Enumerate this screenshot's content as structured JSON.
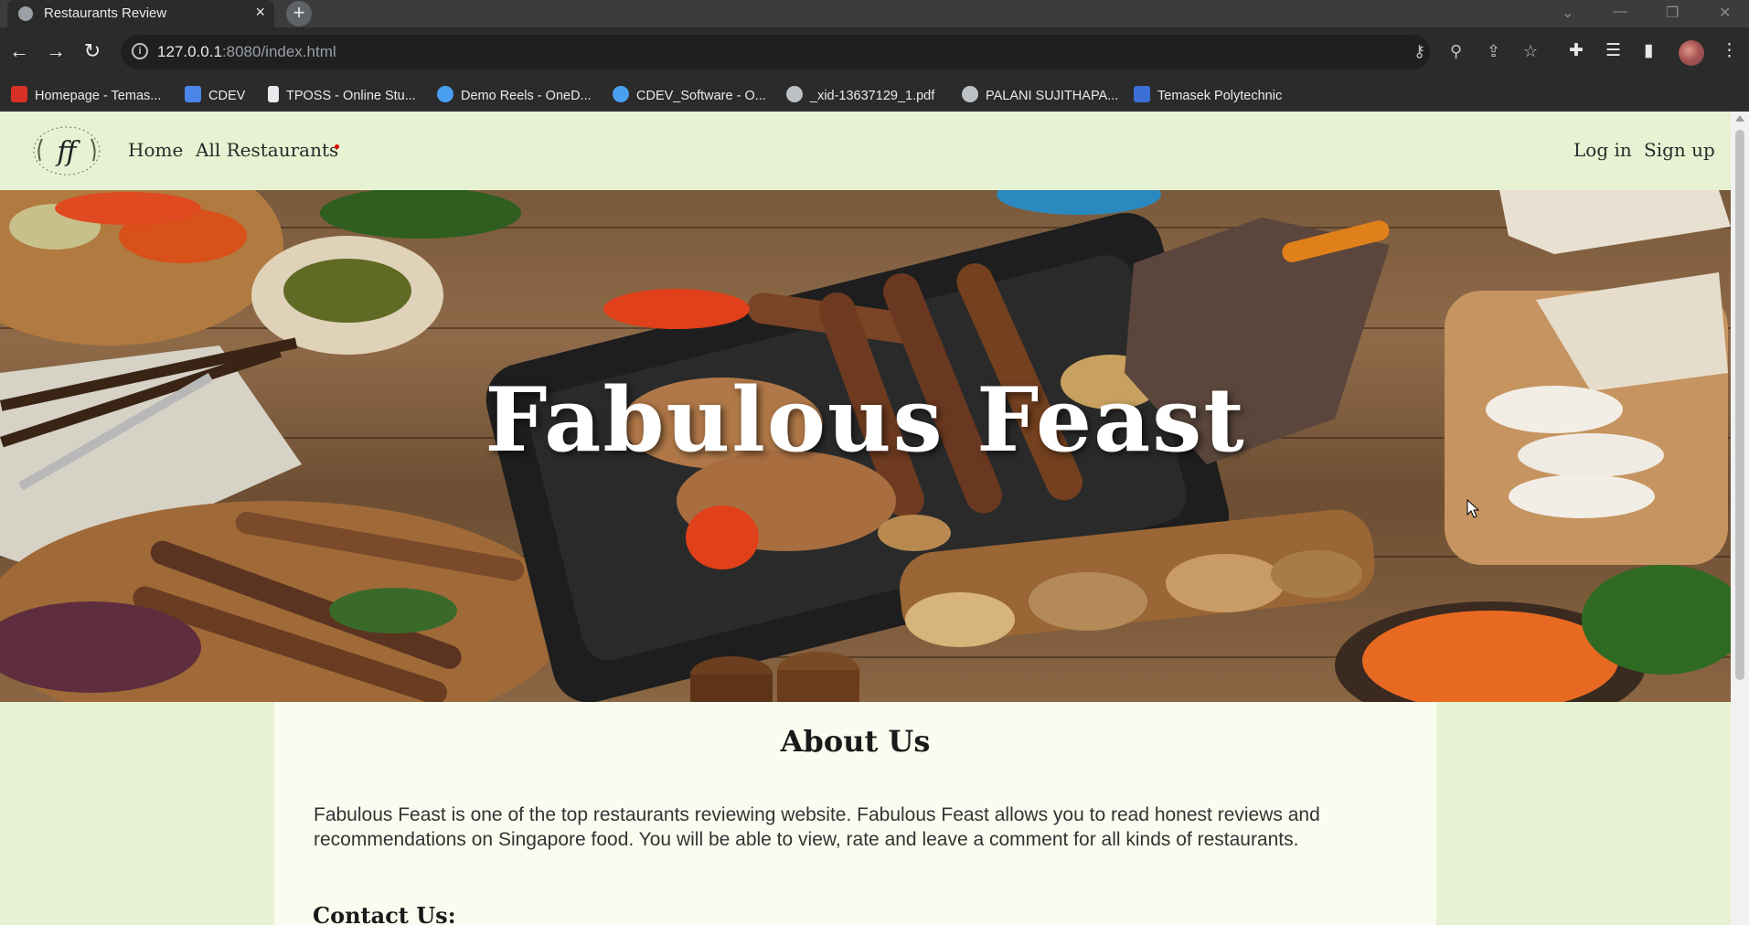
{
  "browser": {
    "tab_title": "Restaurants Review",
    "tab_close": "×",
    "new_tab": "+",
    "url_host": "127.0.0.1",
    "url_rest": ":8080/index.html",
    "bookmarks": [
      {
        "label": "Homepage - Temas...",
        "color": "#d93025",
        "icon": "tp-icon"
      },
      {
        "label": "CDEV",
        "color": "#4a86e8",
        "icon": "video-icon"
      },
      {
        "label": "TPOSS - Online Stu...",
        "color": "#e8eaed",
        "icon": "document-icon"
      },
      {
        "label": "Demo Reels - OneD...",
        "color": "#4a9ff0",
        "icon": "cloud-icon"
      },
      {
        "label": "CDEV_Software - O...",
        "color": "#4a9ff0",
        "icon": "cloud-icon"
      },
      {
        "label": "_xid-13637129_1.pdf",
        "color": "#bdc1c6",
        "icon": "globe-icon"
      },
      {
        "label": "PALANI SUJITHAPA...",
        "color": "#bdc1c6",
        "icon": "globe-icon"
      },
      {
        "label": "Temasek Polytechnic",
        "color": "#3b6fd6",
        "icon": "bb-icon"
      }
    ]
  },
  "site": {
    "nav": {
      "home": "Home",
      "all_restaurants": "All Restaurants",
      "login": "Log in",
      "signup": "Sign up"
    },
    "logo_text": "ff",
    "hero_title": "Fabulous Feast",
    "about_title": "About Us",
    "about_text": "Fabulous Feast is one of the top restaurants reviewing website. Fabulous Feast allows you to read honest reviews and recommendations on Singapore food. You will be able to view, rate and leave a comment for all kinds of restaurants.",
    "contact_title": "Contact Us:"
  },
  "colors": {
    "nav_bg": "#e6f2d2",
    "content_bg": "#fafcf0",
    "accent": "#d00000"
  }
}
